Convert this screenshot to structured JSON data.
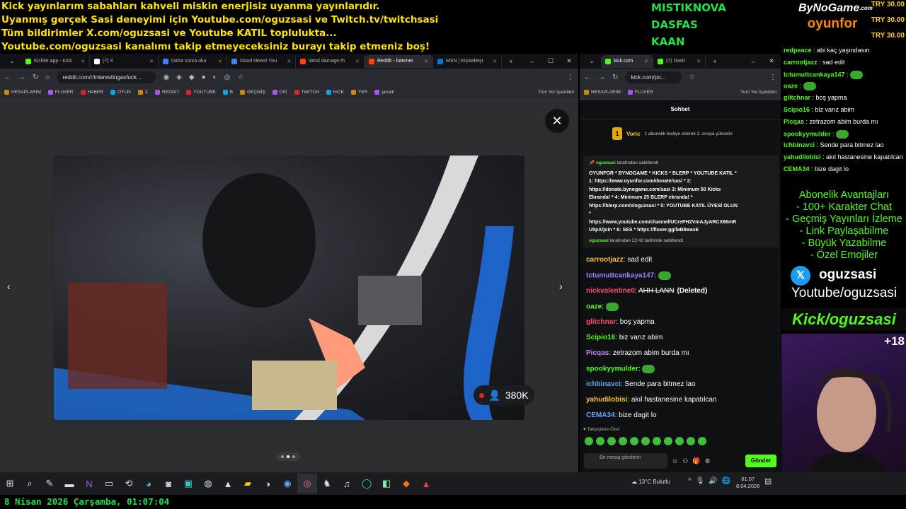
{
  "ticker": [
    "Kick yayınlarım sabahları kahveli miskin enerjisiz uyanma yayınlarıdır.",
    "Uyanmış gerçek Sasi deneyimi için Youtube.com/oguzsasi ve Twitch.tv/twitchsasi",
    "Tüm bildirimler X.com/oguzsasi ve Youtube KATIL toplulukta...",
    "Youtube.com/oguzsasi kanalımı takip etmeyeceksiniz burayı takip etmeniz boş!"
  ],
  "donors": [
    "MISTIKNOVA",
    "DASFAS",
    "KAAN"
  ],
  "brand": {
    "top": "ByNoGame",
    "sub": ".com",
    "bottom": "oyunfor"
  },
  "donations": [
    "TRY 30.00",
    "TRY 30.00",
    "TRY 30.00"
  ],
  "browser1": {
    "tabs": [
      {
        "label": "Kicklet.app - Kick",
        "color": "#53fc18"
      },
      {
        "label": "(7) X",
        "color": "#ffffff"
      },
      {
        "label": "Daha sonra oku",
        "color": "#3b82f6"
      },
      {
        "label": "Good News! You",
        "color": "#4285f4"
      },
      {
        "label": "Wind damage th",
        "color": "#ff4500"
      },
      {
        "label": "Reddit - İnternet",
        "color": "#ff4500"
      },
      {
        "label": "MSN | Kişiselleşt",
        "color": "#0078d4"
      }
    ],
    "url": "reddit.com/r/interestingasfuck...",
    "bookmarks": [
      "HESAPLARIM",
      "FLUXER",
      "HABER",
      "OYUN",
      "X",
      "REDDIT",
      "YOUTUBE",
      "B",
      "GEÇMİŞ",
      "DSİ",
      "TWITCH",
      "KICK",
      "YER",
      "yeralti"
    ],
    "all_bookmarks": "Tüm Yer İşaretleri",
    "viewer_count": "380K",
    "close_symbol": "✕"
  },
  "browser2": {
    "tabs": [
      {
        "label": "kick.com",
        "color": "#53fc18"
      },
      {
        "label": "(7) Dash",
        "color": "#53fc18"
      }
    ],
    "url": "kick.com/po...",
    "bookmarks": [
      "HESAPLARIM",
      "FLUXER"
    ],
    "all_bookmarks": "Tüm Yer İşaretleri",
    "chat_title": "Sohbet",
    "gift": {
      "user": "Voric",
      "rank": "1",
      "text": "1 abonelik hediye ederek 2. sıraya yükselin"
    },
    "pinned": {
      "by": "oguzsasi",
      "by_suffix": "tarafından sabitlendi",
      "lines": [
        "OYUNFOR * BYNOGAME * KICKS * BLERP * YOUTUBE KATIL *",
        "1: https://www.oyunfor.com/donate/sasi * 2:",
        "https://donate.bynogame.com/sasi 3: Minimum 50 Kicks",
        "Ekranda! * 4: Minimum 25 BLERP ekranda! *",
        "https://blerp.com/x/oguzsasi * 5: YOUTUBE KATIL ÜYESİ OLUN",
        "*",
        "https://www.youtube.com/channel/UCrePH2VmAJyARCX66mR",
        "U5pA/join * 6: SES * https://fluxer.gg/laB8waxE"
      ],
      "footer_user": "oguzsasi",
      "footer_text": "tarafından 22:42 tarihinde sabitlendi"
    },
    "messages": [
      {
        "user": "carrootjazz",
        "color": "#f4c431",
        "text": "sad edit"
      },
      {
        "user": "tctumuttcankaya147",
        "color": "#a27fff",
        "text": ""
      },
      {
        "user": "nickvalentine0",
        "color": "#ff4d6d",
        "text": "AHH LANN",
        "deleted": "(Deleted)"
      },
      {
        "user": "oaze",
        "color": "#53fc18",
        "text": ""
      },
      {
        "user": "glitchnar",
        "color": "#ff4d6d",
        "text": "boş yapma"
      },
      {
        "user": "Scipio16",
        "color": "#53fc18",
        "text": "biz varız abim"
      },
      {
        "user": "Picqas",
        "color": "#c084fc",
        "text": "zetrazom abim burda mı"
      },
      {
        "user": "spookyymulder",
        "color": "#53fc18",
        "text": ""
      },
      {
        "user": "ichbinavci",
        "color": "#60a5fa",
        "text": "Sende para bitmez lao"
      },
      {
        "user": "yahudilobisi",
        "color": "#f4c431",
        "text": "akıl hastanesine kapatılcan"
      },
      {
        "user": "CEMA34",
        "color": "#60a5fa",
        "text": "bize dagit lo"
      }
    ],
    "followers_label": "Takipçilere Özel",
    "input_placeholder": "Bir mesaj gönderin",
    "send_label": "Gönder"
  },
  "overlay_chat": [
    {
      "user": "redpeace",
      "text": "abi kaç yaşındasın"
    },
    {
      "user": "carrootjazz",
      "text": "sad edit"
    },
    {
      "user": "tctumuttcankaya147",
      "text": ""
    },
    {
      "user": "oaze",
      "text": ""
    },
    {
      "user": "glitchnar",
      "text": "boş yapma"
    },
    {
      "user": "Scipio16",
      "text": "biz varız abim"
    },
    {
      "user": "Picqas",
      "text": "zetrazom abim burda mı"
    },
    {
      "user": "spookyymulder",
      "text": ""
    },
    {
      "user": "ichbinavci",
      "text": "Sende para bitmez lao"
    },
    {
      "user": "yahudilobisi",
      "text": "akıl hastanesine kapatılcan"
    },
    {
      "user": "CEMA34",
      "text": "bize dagit lo"
    }
  ],
  "perks": [
    "Abonelik Avantajları",
    "- 100+ Karakter Chat",
    "- Geçmiş Yayınları İzleme",
    "- Link Paylaşabilme",
    "- Büyük Yazabilme",
    "- Özel Emojiler"
  ],
  "social": {
    "x_handle": "oguzsasi",
    "youtube": "Youtube/oguzsasi",
    "kick": "Kick/oguzsasi"
  },
  "age_badge": "+18",
  "taskbar": {
    "weather": "13°C  Bulutlu",
    "time": "01:07",
    "date": "8.04.2026"
  },
  "datetime_banner": "8 Nisan 2026 Çarşamba, 01:07:04"
}
